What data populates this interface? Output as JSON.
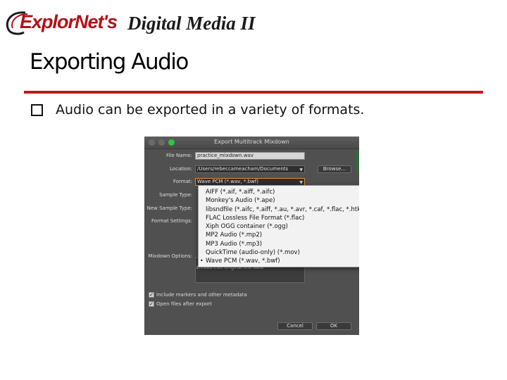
{
  "header": {
    "logo_brand": "ExplorNet's",
    "logo_product": "Digital Media II",
    "title": "Exporting Audio"
  },
  "bullet": {
    "text": "Audio can be exported in a variety of formats."
  },
  "dialog": {
    "title": "Export Multitrack Mixdown",
    "fields": {
      "file_name_label": "File Name:",
      "file_name_value": "practice_mixdown.wav",
      "location_label": "Location:",
      "location_value": "/Users/rebeccameacham/Documents",
      "browse_label": "Browse...",
      "format_label": "Format:",
      "format_value": "Wave PCM (*.wav, *.bwf)",
      "sample_type_label": "Sample Type:",
      "new_sample_type_label": "New Sample Type:",
      "format_settings_label": "Format Settings:",
      "mixdown_options_label": "Mixdown Options:",
      "embed_text": "Embed Edit Original link data"
    },
    "format_options": [
      "AIFF (*.aif, *.aiff, *.aifc)",
      "Monkey's Audio (*.ape)",
      "libsndfile (*.aifc, *.aiff, *.au, *.avr, *.caf, *.flac, *.htk, *.i",
      "FLAC Lossless File Format (*.flac)",
      "Xiph OGG container (*.ogg)",
      "MP2 Audio (*.mp2)",
      "MP3 Audio (*.mp3)",
      "QuickTime (audio-only) (*.mov)",
      "Wave PCM (*.wav, *.bwf)"
    ],
    "selected_option_index": 8,
    "checkboxes": {
      "include_markers": "Include markers and other metadata",
      "open_files": "Open files after export"
    },
    "buttons": {
      "cancel": "Cancel",
      "ok": "OK"
    }
  },
  "colors": {
    "brand_red": "#c0181d",
    "dialog_bg": "#505050",
    "traffic_green": "#27c93f",
    "format_focus": "#d8902c"
  }
}
